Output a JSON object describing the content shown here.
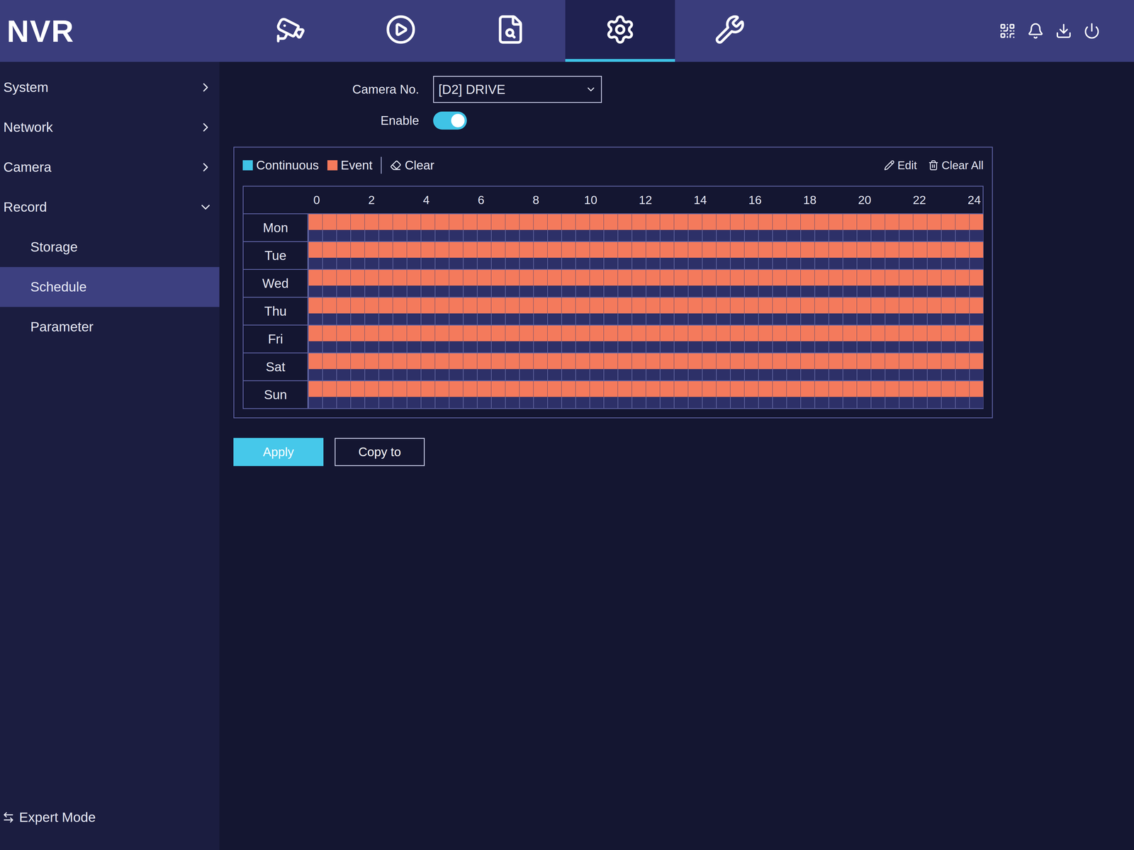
{
  "header": {
    "logo": "NVR",
    "tabs": [
      {
        "selected": false
      },
      {
        "selected": false
      },
      {
        "selected": false
      },
      {
        "selected": true
      },
      {
        "selected": false
      }
    ]
  },
  "sidebar": {
    "items": [
      {
        "label": "System",
        "expanded": false,
        "selected": false,
        "children": []
      },
      {
        "label": "Network",
        "expanded": false,
        "selected": false,
        "children": []
      },
      {
        "label": "Camera",
        "expanded": false,
        "selected": false,
        "children": []
      },
      {
        "label": "Record",
        "expanded": true,
        "selected": false,
        "children": [
          {
            "label": "Storage",
            "selected": false
          },
          {
            "label": "Schedule",
            "selected": true
          },
          {
            "label": "Parameter",
            "selected": false
          }
        ]
      }
    ],
    "footer": "Expert Mode"
  },
  "form": {
    "camera_label": "Camera No.",
    "camera_value": "[D2] DRIVE",
    "enable_label": "Enable",
    "enabled": true
  },
  "legend": [
    {
      "label": "Continuous",
      "color": "#3fc3e6"
    },
    {
      "label": "Event",
      "color": "#f47a5c"
    }
  ],
  "tools": {
    "clear": "Clear",
    "edit": "Edit",
    "clear_all": "Clear All"
  },
  "schedule": {
    "hours": [
      "0",
      "2",
      "4",
      "6",
      "8",
      "10",
      "12",
      "14",
      "16",
      "18",
      "20",
      "22",
      "24"
    ],
    "days": [
      {
        "label": "Mon",
        "segments": [
          {
            "start": 0,
            "end": 24,
            "type": "Event"
          }
        ]
      },
      {
        "label": "Tue",
        "segments": [
          {
            "start": 0,
            "end": 24,
            "type": "Event"
          }
        ]
      },
      {
        "label": "Wed",
        "segments": [
          {
            "start": 0,
            "end": 24,
            "type": "Event"
          }
        ]
      },
      {
        "label": "Thu",
        "segments": [
          {
            "start": 0,
            "end": 24,
            "type": "Event"
          }
        ]
      },
      {
        "label": "Fri",
        "segments": [
          {
            "start": 0,
            "end": 24,
            "type": "Event"
          }
        ]
      },
      {
        "label": "Sat",
        "segments": [
          {
            "start": 0,
            "end": 24,
            "type": "Event"
          }
        ]
      },
      {
        "label": "Sun",
        "segments": [
          {
            "start": 0,
            "end": 24,
            "type": "Event"
          }
        ]
      }
    ]
  },
  "buttons": [
    {
      "label": "Apply",
      "primary": true
    },
    {
      "label": "Copy to",
      "primary": false
    }
  ]
}
